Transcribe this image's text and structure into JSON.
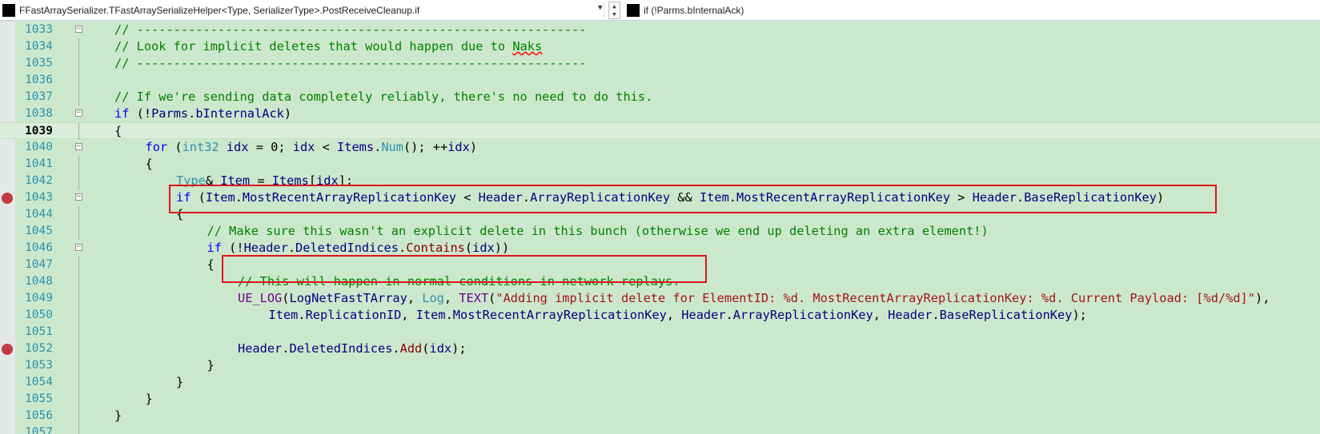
{
  "navbar": {
    "scope_dropdown": "FFastArraySerializer.TFastArraySerializeHelper<Type, SerializerType>.PostReceiveCleanup.if",
    "member_dropdown": "if (!Parms.bInternalAck)",
    "dropdown_arrow_icon": "chevron-down-icon",
    "spinner_up": "▲",
    "spinner_down": "▼"
  },
  "editor": {
    "current_line": 1039,
    "theme_background": "#cce8cc",
    "breakpoint_color": "#c23a43",
    "highlight_box_color": "#e0131b",
    "lines": [
      {
        "num": "1033",
        "bp": false,
        "fold": "minus",
        "indent": 0,
        "tokens": [
          {
            "t": "// -------------------------------------------------------------",
            "c": "cm"
          }
        ]
      },
      {
        "num": "1034",
        "bp": false,
        "fold": "",
        "indent": 0,
        "tokens": [
          {
            "t": "// Look for implicit deletes that would happen due to ",
            "c": "cm"
          },
          {
            "t": "Naks",
            "c": "cm squig"
          }
        ]
      },
      {
        "num": "1035",
        "bp": false,
        "fold": "",
        "indent": 0,
        "tokens": [
          {
            "t": "// -------------------------------------------------------------",
            "c": "cm"
          }
        ]
      },
      {
        "num": "1036",
        "bp": false,
        "fold": "",
        "indent": 0,
        "tokens": []
      },
      {
        "num": "1037",
        "bp": false,
        "fold": "",
        "indent": 0,
        "tokens": [
          {
            "t": "// If we're sending data completely reliably, there's no need to do this.",
            "c": "cm"
          }
        ]
      },
      {
        "num": "1038",
        "bp": false,
        "fold": "minus",
        "indent": 0,
        "tokens": [
          {
            "t": "if",
            "c": "kw"
          },
          {
            "t": " (!"
          },
          {
            "t": "Parms",
            "c": "pr"
          },
          {
            "t": "."
          },
          {
            "t": "bInternalAck",
            "c": "pr"
          },
          {
            "t": ")"
          }
        ]
      },
      {
        "num": "1039",
        "bp": false,
        "fold": "",
        "indent": 0,
        "tokens": [
          {
            "t": "{"
          }
        ]
      },
      {
        "num": "1040",
        "bp": false,
        "fold": "minus",
        "indent": 1,
        "tokens": [
          {
            "t": "for",
            "c": "kw"
          },
          {
            "t": " ("
          },
          {
            "t": "int32",
            "c": "ty"
          },
          {
            "t": " "
          },
          {
            "t": "idx",
            "c": "pr"
          },
          {
            "t": " = 0; "
          },
          {
            "t": "idx",
            "c": "pr"
          },
          {
            "t": " < "
          },
          {
            "t": "Items",
            "c": "pr"
          },
          {
            "t": "."
          },
          {
            "t": "Num",
            "c": "ty"
          },
          {
            "t": "(); ++"
          },
          {
            "t": "idx",
            "c": "pr"
          },
          {
            "t": ")"
          }
        ]
      },
      {
        "num": "1041",
        "bp": false,
        "fold": "",
        "indent": 1,
        "tokens": [
          {
            "t": "{"
          }
        ]
      },
      {
        "num": "1042",
        "bp": false,
        "fold": "",
        "indent": 2,
        "tokens": [
          {
            "t": "Type",
            "c": "ty"
          },
          {
            "t": "& "
          },
          {
            "t": "Item",
            "c": "pr"
          },
          {
            "t": " = "
          },
          {
            "t": "Items",
            "c": "pr"
          },
          {
            "t": "["
          },
          {
            "t": "idx",
            "c": "pr"
          },
          {
            "t": "];"
          }
        ]
      },
      {
        "num": "1043",
        "bp": true,
        "fold": "minus",
        "indent": 2,
        "tokens": [
          {
            "t": "if",
            "c": "kw"
          },
          {
            "t": " ("
          },
          {
            "t": "Item",
            "c": "pr"
          },
          {
            "t": "."
          },
          {
            "t": "MostRecentArrayReplicationKey",
            "c": "pr"
          },
          {
            "t": " < "
          },
          {
            "t": "Header",
            "c": "pr"
          },
          {
            "t": "."
          },
          {
            "t": "ArrayReplicationKey",
            "c": "pr"
          },
          {
            "t": " && "
          },
          {
            "t": "Item",
            "c": "pr"
          },
          {
            "t": "."
          },
          {
            "t": "MostRecentArrayReplicationKey",
            "c": "pr"
          },
          {
            "t": " > "
          },
          {
            "t": "Header",
            "c": "pr"
          },
          {
            "t": "."
          },
          {
            "t": "BaseReplicationKey",
            "c": "pr"
          },
          {
            "t": ")"
          }
        ]
      },
      {
        "num": "1044",
        "bp": false,
        "fold": "",
        "indent": 2,
        "tokens": [
          {
            "t": "{"
          }
        ]
      },
      {
        "num": "1045",
        "bp": false,
        "fold": "",
        "indent": 3,
        "tokens": [
          {
            "t": "// Make sure this wasn't an explicit delete in this bunch (otherwise we end up deleting an extra element!)",
            "c": "cm"
          }
        ]
      },
      {
        "num": "1046",
        "bp": false,
        "fold": "minus",
        "indent": 3,
        "tokens": [
          {
            "t": "if",
            "c": "kw"
          },
          {
            "t": " (!"
          },
          {
            "t": "Header",
            "c": "pr"
          },
          {
            "t": "."
          },
          {
            "t": "DeletedIndices",
            "c": "pr"
          },
          {
            "t": "."
          },
          {
            "t": "Contains",
            "c": "fn"
          },
          {
            "t": "("
          },
          {
            "t": "idx",
            "c": "pr"
          },
          {
            "t": "))"
          }
        ]
      },
      {
        "num": "1047",
        "bp": false,
        "fold": "",
        "indent": 3,
        "tokens": [
          {
            "t": "{"
          }
        ]
      },
      {
        "num": "1048",
        "bp": false,
        "fold": "",
        "indent": 4,
        "tokens": [
          {
            "t": "// This will happen in normal conditions in network replays.",
            "c": "cm"
          }
        ]
      },
      {
        "num": "1049",
        "bp": false,
        "fold": "",
        "indent": 4,
        "tokens": [
          {
            "t": "UE_LOG",
            "c": "mac"
          },
          {
            "t": "("
          },
          {
            "t": "LogNetFastTArray",
            "c": "pr"
          },
          {
            "t": ", "
          },
          {
            "t": "Log",
            "c": "ty"
          },
          {
            "t": ", "
          },
          {
            "t": "TEXT",
            "c": "mac"
          },
          {
            "t": "("
          },
          {
            "t": "\"Adding implicit delete for ElementID: %d. MostRecentArrayReplicationKey: %d. Current Payload: [%d/%d]\"",
            "c": "st"
          },
          {
            "t": "),"
          }
        ]
      },
      {
        "num": "1050",
        "bp": false,
        "fold": "",
        "indent": 5,
        "tokens": [
          {
            "t": "Item",
            "c": "pr"
          },
          {
            "t": "."
          },
          {
            "t": "ReplicationID",
            "c": "pr"
          },
          {
            "t": ", "
          },
          {
            "t": "Item",
            "c": "pr"
          },
          {
            "t": "."
          },
          {
            "t": "MostRecentArrayReplicationKey",
            "c": "pr"
          },
          {
            "t": ", "
          },
          {
            "t": "Header",
            "c": "pr"
          },
          {
            "t": "."
          },
          {
            "t": "ArrayReplicationKey",
            "c": "pr"
          },
          {
            "t": ", "
          },
          {
            "t": "Header",
            "c": "pr"
          },
          {
            "t": "."
          },
          {
            "t": "BaseReplicationKey",
            "c": "pr"
          },
          {
            "t": ");"
          }
        ]
      },
      {
        "num": "1051",
        "bp": false,
        "fold": "",
        "indent": 0,
        "tokens": []
      },
      {
        "num": "1052",
        "bp": true,
        "fold": "",
        "indent": 4,
        "tokens": [
          {
            "t": "Header",
            "c": "pr"
          },
          {
            "t": "."
          },
          {
            "t": "DeletedIndices",
            "c": "pr"
          },
          {
            "t": "."
          },
          {
            "t": "Add",
            "c": "fn"
          },
          {
            "t": "("
          },
          {
            "t": "idx",
            "c": "pr"
          },
          {
            "t": ");"
          }
        ]
      },
      {
        "num": "1053",
        "bp": false,
        "fold": "",
        "indent": 3,
        "tokens": [
          {
            "t": "}"
          }
        ]
      },
      {
        "num": "1054",
        "bp": false,
        "fold": "",
        "indent": 2,
        "tokens": [
          {
            "t": "}"
          }
        ]
      },
      {
        "num": "1055",
        "bp": false,
        "fold": "",
        "indent": 1,
        "tokens": [
          {
            "t": "}"
          }
        ]
      },
      {
        "num": "1056",
        "bp": false,
        "fold": "",
        "indent": 0,
        "tokens": [
          {
            "t": "}"
          }
        ]
      },
      {
        "num": "1057",
        "bp": false,
        "fold": "",
        "indent": 0,
        "tokens": []
      }
    ]
  }
}
